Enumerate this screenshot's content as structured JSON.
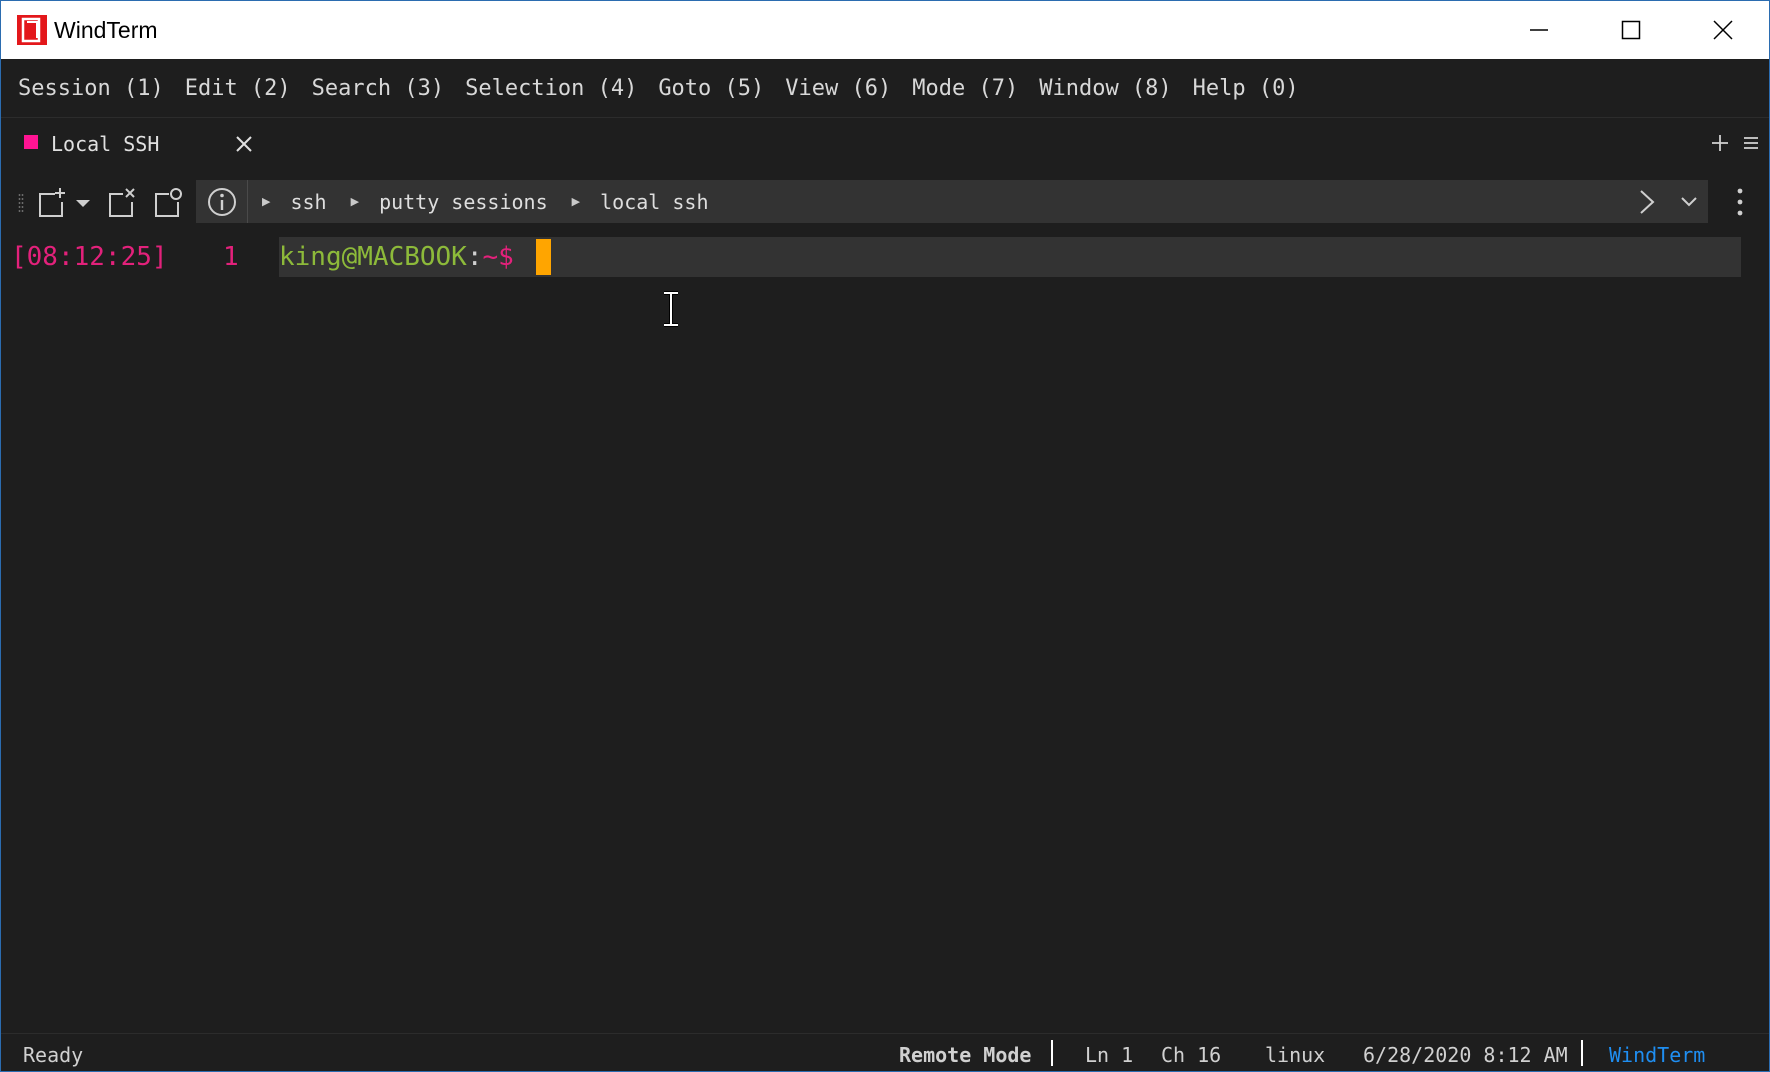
{
  "window": {
    "title": "WindTerm",
    "accent": "#e3171b"
  },
  "menu": [
    {
      "label": "Session (1)"
    },
    {
      "label": "Edit (2)"
    },
    {
      "label": "Search (3)"
    },
    {
      "label": "Selection (4)"
    },
    {
      "label": "Goto (5)"
    },
    {
      "label": "View (6)"
    },
    {
      "label": "Mode (7)"
    },
    {
      "label": "Window (8)"
    },
    {
      "label": "Help (0)"
    }
  ],
  "tabs": [
    {
      "label": "Local SSH",
      "color": "#ff1493",
      "active": true
    }
  ],
  "toolbar": {
    "icons": [
      "new-session-icon",
      "dropdown-arrow-icon",
      "close-session-icon",
      "duplicate-session-icon",
      "info-icon"
    ],
    "breadcrumb": [
      "ssh",
      "putty sessions",
      "local ssh"
    ]
  },
  "terminal": {
    "timestamp": "[08:12:25]",
    "line_number": "1",
    "prompt_user": "king@MACBOOK",
    "prompt_colon": ":",
    "prompt_path": "~$",
    "cursor_color": "#ffa500"
  },
  "status": {
    "ready": "Ready",
    "mode": "Remote Mode",
    "line": "Ln 1",
    "char": "Ch 16",
    "os": "linux",
    "datetime": "6/28/2020 8:12 AM",
    "brand": "WindTerm",
    "brand_color": "#1f8ef1"
  }
}
